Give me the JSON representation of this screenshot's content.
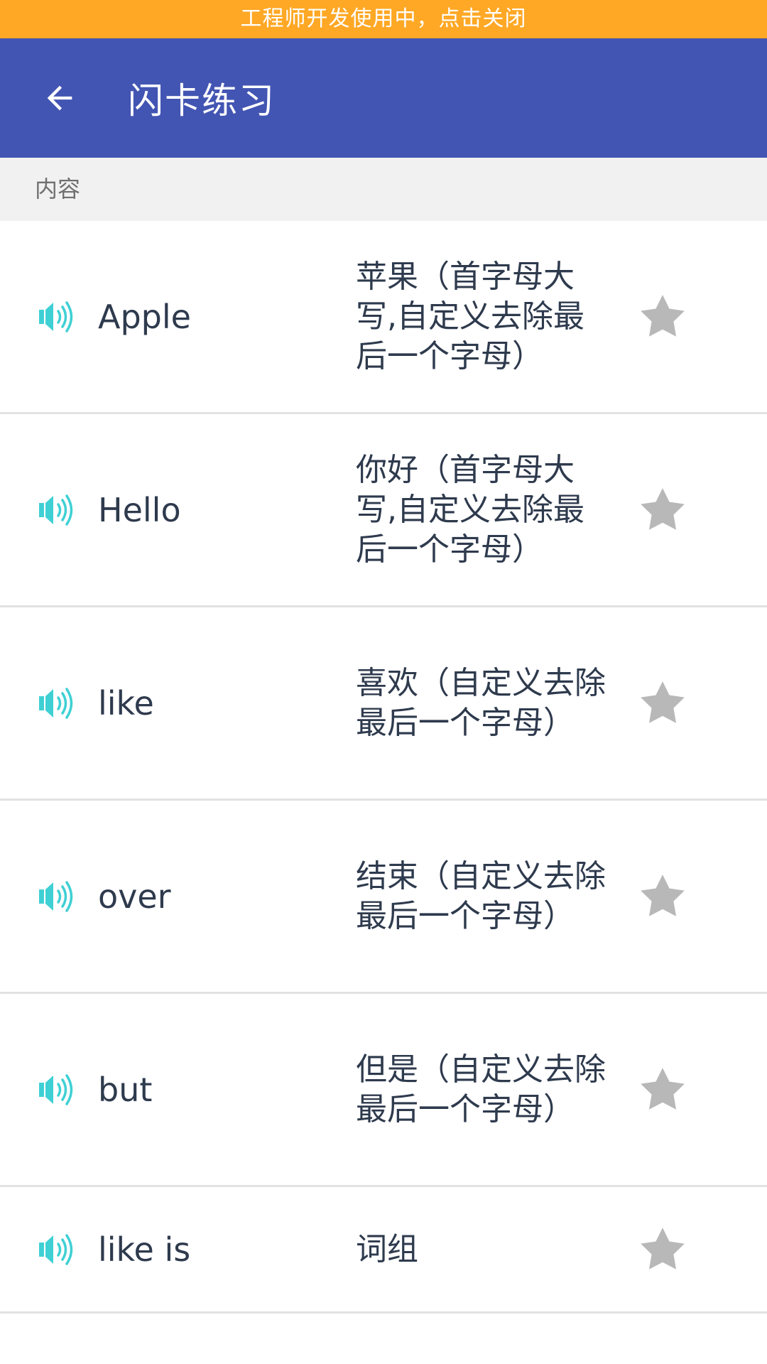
{
  "banner": {
    "text": "工程师开发使用中，点击关闭"
  },
  "appbar": {
    "title": "闪卡练习"
  },
  "section": {
    "header": "内容"
  },
  "colors": {
    "banner_bg": "#FFA825",
    "appbar_bg": "#4355B3",
    "speaker_icon": "#3FD0D4",
    "star_icon": "#B8B8B8",
    "text": "#2E3A4D"
  },
  "icons": {
    "back": "arrow-left-icon",
    "speaker": "speaker-icon",
    "favorite": "star-icon"
  },
  "cards": [
    {
      "word": "Apple",
      "meaning": "苹果（首字母大写,自定义去除最后一个字母）"
    },
    {
      "word": "Hello",
      "meaning": "你好（首字母大写,自定义去除最后一个字母）"
    },
    {
      "word": "like",
      "meaning": "喜欢（自定义去除最后一个字母）"
    },
    {
      "word": "over",
      "meaning": "结束（自定义去除最后一个字母）"
    },
    {
      "word": "but",
      "meaning": "但是（自定义去除最后一个字母）"
    },
    {
      "word": "like is",
      "meaning": "词组"
    }
  ]
}
